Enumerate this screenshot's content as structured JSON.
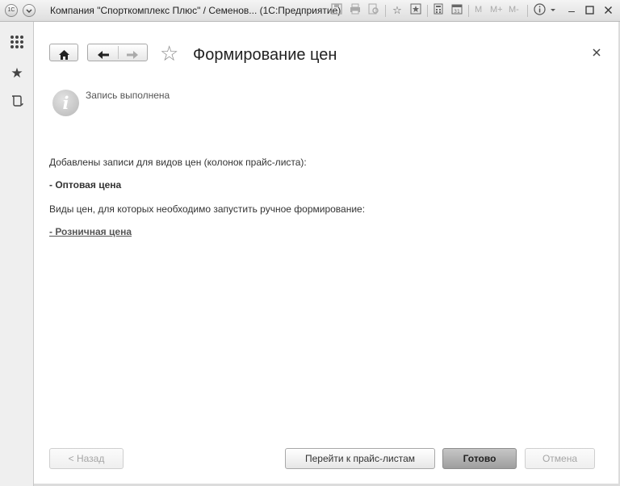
{
  "window": {
    "title": "Компания \"Спорткомплекс Плюс\" / Семенов... (1С:Предприятие)",
    "app_icon": "1C",
    "toolbar_letters": [
      "M",
      "M+",
      "M-"
    ]
  },
  "form": {
    "title": "Формирование цен",
    "info_message": "Запись выполнена",
    "lines": {
      "added_intro": "Добавлены записи для видов цен (колонок прайс-листа):",
      "added_item": "- Оптовая цена",
      "manual_intro": "Виды цен, для которых необходимо запустить ручное формирование:",
      "manual_item": "- Розничная цена"
    }
  },
  "buttons": {
    "back": "< Назад",
    "goto_pricelists": "Перейти к прайс-листам",
    "done": "Готово",
    "cancel": "Отмена"
  },
  "colors": {
    "primary_button": "#a9a9a9",
    "content_bg": "#ffffff",
    "sidebar_bg": "#efefef"
  }
}
